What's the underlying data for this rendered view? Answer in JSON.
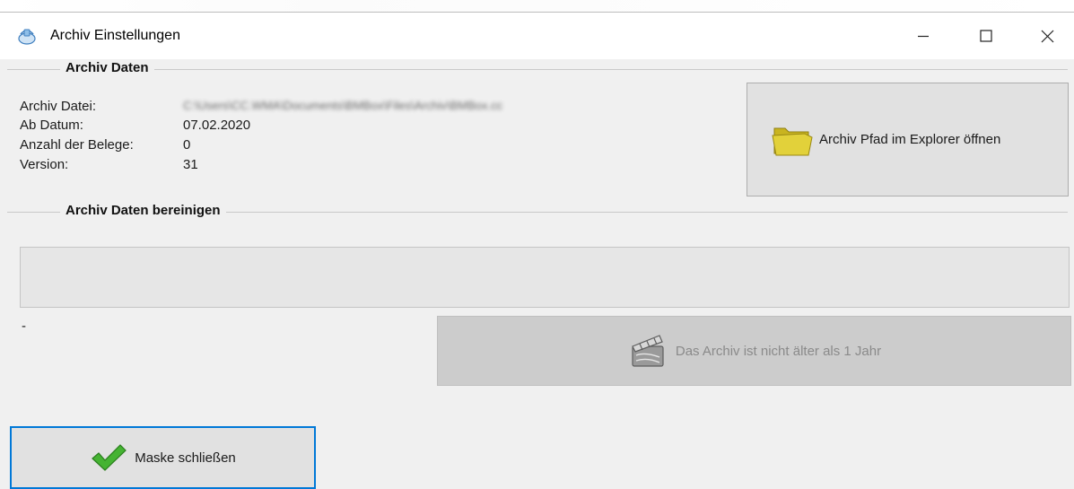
{
  "window": {
    "title": "Archiv Einstellungen",
    "controls": {
      "minimize": "minimize-icon",
      "maximize": "maximize-icon",
      "close": "close-icon"
    }
  },
  "archiv_daten": {
    "group_title": "Archiv Daten",
    "fields": [
      {
        "label": "Archiv Datei:",
        "value": "C:\\Users\\CC.WMA\\Documents\\BMBox\\Files\\Archiv\\BMBox.cc"
      },
      {
        "label": "Ab Datum:",
        "value": "07.02.2020"
      },
      {
        "label": "Anzahl der Belege:",
        "value": "0"
      },
      {
        "label": "Version:",
        "value": "31"
      }
    ],
    "open_explorer_button": "Archiv Pfad im Explorer öffnen"
  },
  "bereinigen": {
    "group_title": "Archiv Daten bereinigen",
    "status_text": "-",
    "clean_button": "Das Archiv ist nicht älter als 1 Jahr",
    "clean_button_enabled": false
  },
  "footer": {
    "close_button": "Maske schließen"
  },
  "colors": {
    "window_bg": "#f0f0f0",
    "titlebar_bg": "#ffffff",
    "button_bg": "#e1e1e1",
    "button_disabled_bg": "#cccccc",
    "default_button_border": "#0078d7",
    "folder_yellow": "#d9c62a",
    "check_green": "#3aa52a"
  }
}
